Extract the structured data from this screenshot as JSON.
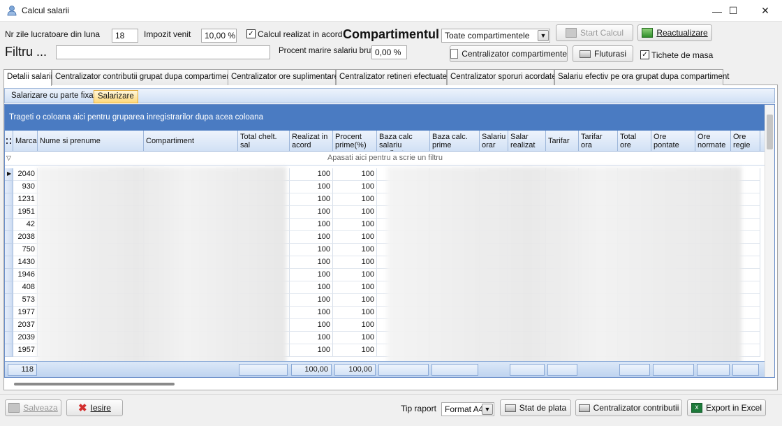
{
  "window": {
    "title": "Calcul salarii",
    "minimize": "—",
    "maximize": "☐",
    "close": "✕"
  },
  "toolbar": {
    "nr_zile_label": "Nr zile lucratoare din luna",
    "nr_zile_value": "18",
    "impozit_label": "Impozit venit",
    "impozit_value": "10,00 %",
    "calcul_acord_label": "Calcul realizat in acord",
    "calcul_acord_checked": true,
    "compartimentul_label": "Compartimentul",
    "compartiment_select": "Toate compartimentele",
    "start_calcul": "Start Calcul",
    "reactualizare": "Reactualizare",
    "filtru_label": "Filtru ...",
    "filtru_value": "",
    "procent_label": "Procent marire salariu brut",
    "procent_value": "0,00 %",
    "centralizator_comp": "Centralizator compartimente",
    "fluturasi": "Fluturasi",
    "tichete_label": "Tichete de masa",
    "tichete_checked": true
  },
  "tabs": [
    "Detalii salarii",
    "Centralizator contributii grupat dupa compartiment",
    "Centralizator ore suplimentare",
    "Centralizator retineri efectuate",
    "Centralizator sporuri acordate",
    "Salariu efectiv pe ora grupat dupa compartiment"
  ],
  "subtabs": [
    "Salarizare cu parte fixa",
    "Salarizare"
  ],
  "grid": {
    "group_hint": "Trageti o coloana aici pentru gruparea inregistrarilor dupa acea coloana",
    "filter_hint": "Apasati aici pentru a scrie un filtru",
    "columns": [
      "Marca",
      "Nume si prenume",
      "Compartiment",
      "Total chelt. sal",
      "Realizat in acord",
      "Procent prime(%)",
      "Baza calc salariu realizat",
      "Baza calc. prime",
      "Salariu orar",
      "Salar realizat",
      "Tarifar",
      "Tarifar ora",
      "Total ore",
      "Ore pontate",
      "Ore normate",
      "Ore regie"
    ],
    "rows": [
      {
        "marca": "2040",
        "realizat": "100",
        "procent": "100"
      },
      {
        "marca": "930",
        "realizat": "100",
        "procent": "100"
      },
      {
        "marca": "1231",
        "realizat": "100",
        "procent": "100"
      },
      {
        "marca": "1951",
        "realizat": "100",
        "procent": "100"
      },
      {
        "marca": "42",
        "realizat": "100",
        "procent": "100"
      },
      {
        "marca": "2038",
        "realizat": "100",
        "procent": "100"
      },
      {
        "marca": "750",
        "realizat": "100",
        "procent": "100"
      },
      {
        "marca": "1430",
        "realizat": "100",
        "procent": "100"
      },
      {
        "marca": "1946",
        "realizat": "100",
        "procent": "100"
      },
      {
        "marca": "408",
        "realizat": "100",
        "procent": "100"
      },
      {
        "marca": "573",
        "realizat": "100",
        "procent": "100"
      },
      {
        "marca": "1977",
        "realizat": "100",
        "procent": "100"
      },
      {
        "marca": "2037",
        "realizat": "100",
        "procent": "100"
      },
      {
        "marca": "2039",
        "realizat": "100",
        "procent": "100"
      },
      {
        "marca": "1957",
        "realizat": "100",
        "procent": "100"
      }
    ],
    "footer": {
      "count": "118",
      "realizat": "100,00",
      "procent": "100,00"
    }
  },
  "bottom": {
    "salveaza": "Salveaza",
    "iesire": "Iesire",
    "tip_raport_label": "Tip raport",
    "tip_raport_value": "Format A4",
    "stat_de_plata": "Stat de plata",
    "centralizator_contributii": "Centralizator contributii",
    "export_excel": "Export in Excel"
  },
  "colors": {
    "grid_group_bar": "#4a7bc2",
    "header_gradient": "#d2e1f5",
    "active_subtab": "#ffd97a",
    "excel_green": "#1d7a3a",
    "iesire_red": "#d32f2f"
  }
}
